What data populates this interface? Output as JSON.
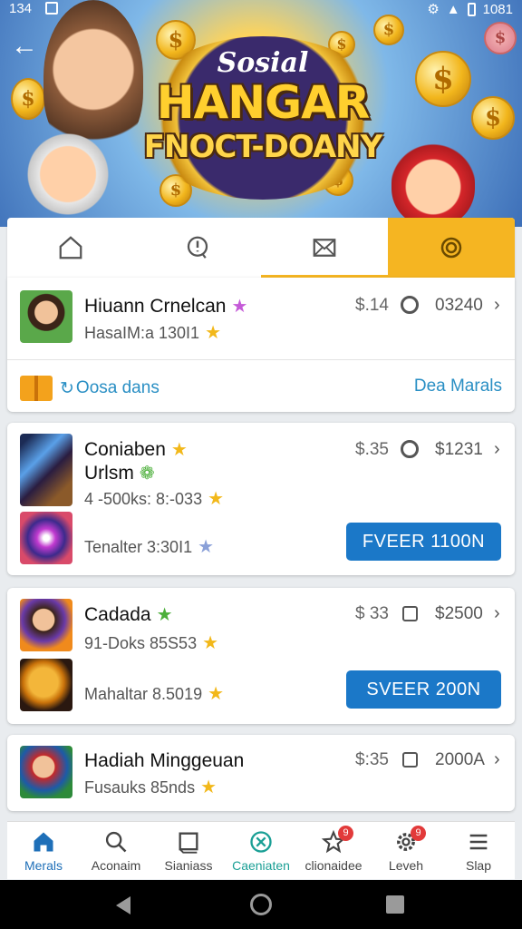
{
  "status_bar": {
    "time": "134",
    "battery": "1081"
  },
  "hero": {
    "logo_top": "Sosial",
    "logo_main": "HANGAR",
    "logo_sub": "FNOCT-DOANY"
  },
  "tabs": [
    {
      "icon": "home-icon"
    },
    {
      "icon": "alert-chat-icon"
    },
    {
      "icon": "mail-icon"
    },
    {
      "icon": "badge-icon"
    }
  ],
  "cards": [
    {
      "rows": [
        {
          "title": "Hiuann Crnelcan",
          "sub": "HasaIM:a 130I1",
          "price": "$.14",
          "amount": "03240",
          "control": "ring"
        }
      ],
      "promo": {
        "left": "Oosa dans",
        "right": "Dea Marals"
      }
    },
    {
      "rows": [
        {
          "title": "Coniaben",
          "title2": "Urlsm",
          "sub": "4 -500ks: 8:-033",
          "price": "$.35",
          "amount": "$1231",
          "control": "ring"
        },
        {
          "sub": "Tenalter 3:30I1"
        }
      ],
      "button": "FVEER 1100N"
    },
    {
      "rows": [
        {
          "title": "Cadada",
          "sub": "91-Doks 85S53",
          "price": "$ 33",
          "amount": "$2500",
          "control": "square"
        },
        {
          "sub": "Mahaltar 8.5019"
        }
      ],
      "button": "SVEER 200N"
    },
    {
      "rows": [
        {
          "title": "Hadiah Minggeuan",
          "sub": "Fusauks 85nds",
          "price": "$:35",
          "amount": "2000A",
          "control": "square"
        }
      ]
    }
  ],
  "bottom_nav": [
    {
      "label": "Merals",
      "icon": "home-icon"
    },
    {
      "label": "Aconaim",
      "icon": "search-icon"
    },
    {
      "label": "Sianiass",
      "icon": "book-icon"
    },
    {
      "label": "Caeniaten",
      "icon": "shield-icon"
    },
    {
      "label": "clionaidee",
      "icon": "star-icon",
      "badge": "9"
    },
    {
      "label": "Leveh",
      "icon": "gear-icon",
      "badge": "9"
    },
    {
      "label": "Slap",
      "icon": "menu-icon"
    }
  ],
  "colors": {
    "accent": "#f5b522",
    "button": "#1b78c8",
    "link": "#2a8fc4",
    "nav_active": "#1e6fb8"
  }
}
